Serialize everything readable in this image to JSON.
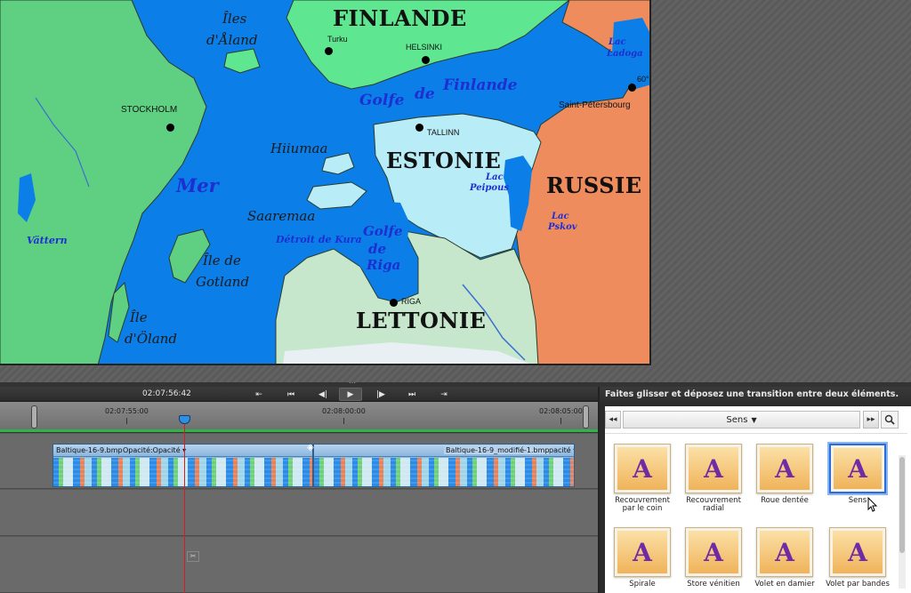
{
  "monitor": {
    "labels": {
      "finlande": "FINLANDE",
      "iles_aland_1": "Îles",
      "iles_aland_2": "d'Åland",
      "turku": "Turku",
      "helsinki": "HELSINKI",
      "lac_ladoga_1": "Lac",
      "lac_ladoga_2": "Ladoga",
      "sixty": "60°",
      "golfe_finlande_1": "Golfe",
      "golfe_finlande_2": "de",
      "golfe_finlande_3": "Finlande",
      "saint_petersbourg": "Saint-Pétersbourg",
      "stockholm": "STOCKHOLM",
      "tallinn": "TALLINN",
      "hiiumaa": "Hiiumaa",
      "estonie": "ESTONIE",
      "mer": "Mer",
      "lac_peipous_1": "Lac",
      "lac_peipous_2": "Peipous",
      "russie": "RUSSIE",
      "saaremaa": "Saaremaa",
      "lac_pskov_1": "Lac",
      "lac_pskov_2": "Pskov",
      "vattern": "Vättern",
      "detroit_kura": "Détroit de Kura",
      "golfe_riga_1": "Golfe",
      "golfe_riga_2": "de",
      "golfe_riga_3": "Riga",
      "ile_gotland_1": "Île de",
      "ile_gotland_2": "Gotland",
      "riga": "RIGA",
      "ile_oland_1": "Île",
      "ile_oland_2": "d'Öland",
      "lettonie": "LETTONIE"
    }
  },
  "transport": {
    "current_timecode": "02:07:56:42",
    "buttons": [
      "⇤",
      "⏮",
      "◀|",
      "▶",
      "|▶",
      "⏭",
      "⇥"
    ]
  },
  "timeline": {
    "ruler_labels": [
      "02:07:55:00",
      "02:08:00:00",
      "02:08:05:00"
    ],
    "clips": [
      {
        "name": "Baltique-16-9.bmp",
        "opacity_label": "Opacité:Opacité ▾"
      },
      {
        "name": "Baltique-16-9_modifié-1.bmp",
        "opacity_label": "pacité ▾"
      }
    ]
  },
  "panel": {
    "title": "Faites glisser et déposez une transition entre deux éléments.",
    "category": "Sens",
    "transitions": [
      {
        "label": "Recouvrement par le coin",
        "glyph": "A"
      },
      {
        "label": "Recouvrement radial",
        "glyph": "A"
      },
      {
        "label": "Roue dentée",
        "glyph": "A"
      },
      {
        "label": "Sens",
        "glyph": "A",
        "selected": true
      },
      {
        "label": "Spirale",
        "glyph": "A"
      },
      {
        "label": "Store vénitien",
        "glyph": "A"
      },
      {
        "label": "Volet en damier",
        "glyph": "A"
      },
      {
        "label": "Volet par bandes",
        "glyph": "A"
      }
    ]
  }
}
